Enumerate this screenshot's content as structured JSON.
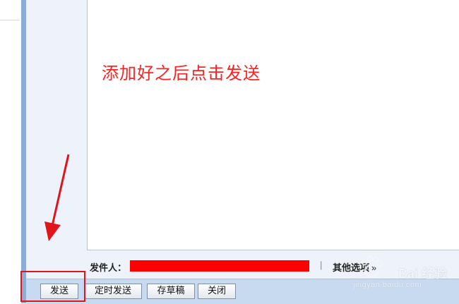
{
  "editor": {
    "body_text": "添加好之后点击发送"
  },
  "sender": {
    "label": "发件人：",
    "separator": "|",
    "more_options_label": "其他选项",
    "more_options_chevron": "»"
  },
  "toolbar": {
    "send_label": "发送",
    "scheduled_send_label": "定时发送",
    "save_draft_label": "存草稿",
    "close_label": "关闭"
  },
  "watermark": {
    "brand_text": "Bai 经验",
    "url_text": "jingyan.baidu.com"
  },
  "colors": {
    "annotation_red": "#e0141a",
    "left_rail": "#8aaed8",
    "toolbar_bg": "#c8daf0",
    "editor_text": "#ff2020"
  },
  "icons": {
    "annotation_arrow": "arrow-down-left-icon"
  }
}
